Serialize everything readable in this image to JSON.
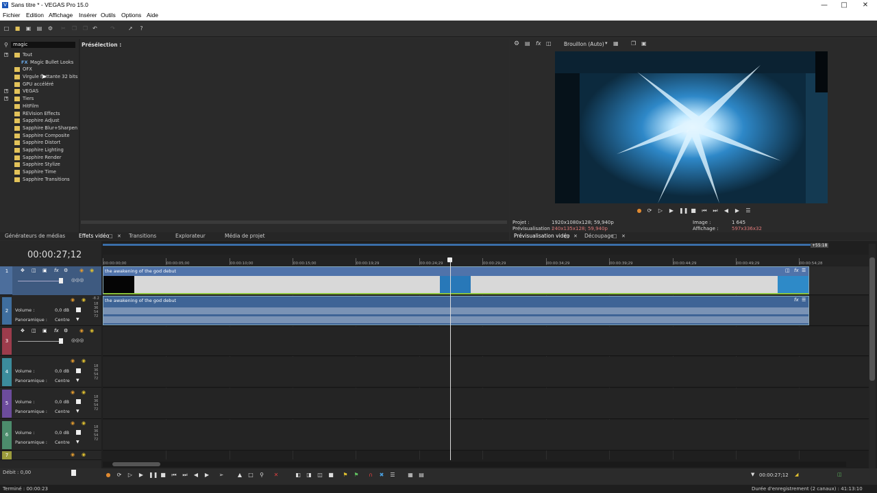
{
  "window": {
    "title": "Sans titre * - VEGAS Pro 15.0"
  },
  "menu": [
    "Fichier",
    "Edition",
    "Affichage",
    "Insérer",
    "Outils",
    "Options",
    "Aide"
  ],
  "search": {
    "value": "magic"
  },
  "preselection_label": "Présélection :",
  "tree": [
    {
      "label": "Tout",
      "expander": "+"
    },
    {
      "label": "Magic Bullet Looks",
      "fx": "FX"
    },
    {
      "label": "OFX"
    },
    {
      "label": "Virgule flottante 32 bits"
    },
    {
      "label": "GPU accéléré"
    },
    {
      "label": "VEGAS",
      "expander": "+"
    },
    {
      "label": "Tiers",
      "expander": "+"
    },
    {
      "label": "HitFilm"
    },
    {
      "label": "REVision Effects"
    },
    {
      "label": "Sapphire Adjust"
    },
    {
      "label": "Sapphire Blur+Sharpen"
    },
    {
      "label": "Sapphire Composite"
    },
    {
      "label": "Sapphire Distort"
    },
    {
      "label": "Sapphire Lighting"
    },
    {
      "label": "Sapphire Render"
    },
    {
      "label": "Sapphire Stylize"
    },
    {
      "label": "Sapphire Time"
    },
    {
      "label": "Sapphire Transitions"
    }
  ],
  "left_tabs": [
    "Générateurs de médias",
    "Effets vidéo",
    "Transitions",
    "Explorateur",
    "Média de projet"
  ],
  "preview": {
    "quality": "Brouillon (Auto)",
    "project_label": "Projet :",
    "project_value": "1920x1080x128; 59,940p",
    "prev_label": "Prévisualisation :",
    "prev_value": "240x135x128; 59,940p",
    "image_label": "Image :",
    "image_value": "1 645",
    "display_label": "Affichage :",
    "display_value": "597x336x32",
    "tabs": [
      "Prévisualisation vidéo",
      "Découpage"
    ]
  },
  "timeline": {
    "timecode": "00:00:27;12",
    "end_marker": "+55:18",
    "ruler": [
      "00:00:00;00",
      "00:00:05;00",
      "00:00:10;00",
      "00:00:15;00",
      "00:00:19;29",
      "00:00:24;29",
      "00:00:29;29",
      "00:00:34;29",
      "00:00:39;29",
      "00:00:44;29",
      "00:00:49;29",
      "00:00:54;28"
    ],
    "video_clip_name": "the awakening of the god debut",
    "audio_clip_name": "the awakening of the god debut",
    "volume_label": "Volume :",
    "volume_value": "0,0 dB",
    "pan_label": "Panoramique :",
    "pan_value": "Centre",
    "meter_marks": [
      "18",
      "36",
      "54",
      "72"
    ],
    "track_numbers": [
      "1",
      "2",
      "3",
      "4",
      "5",
      "6",
      "7"
    ],
    "top_meter": "-8.2"
  },
  "bottom": {
    "rate": "Débit : 0,00",
    "cursor_time": "00:00:27;12"
  },
  "status": {
    "left": "Terminé : 00:00:23",
    "right": "Durée d'enregistrement (2 canaux) : 41:13:10"
  },
  "colors": {
    "track1": "#4c6e9c",
    "track2": "#3f6e9e",
    "track3": "#9c3c4c",
    "track4": "#3c8c9c",
    "track5": "#6c4c9c",
    "track6": "#4c8c6c",
    "track7": "#9c9c3c"
  }
}
